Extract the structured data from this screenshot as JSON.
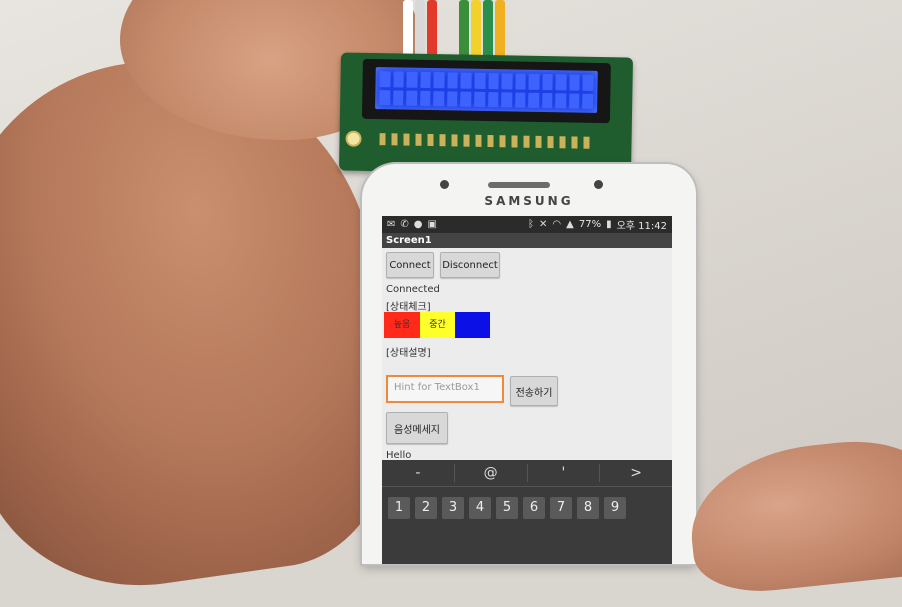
{
  "phone": {
    "brand": "SAMSUNG"
  },
  "status_bar": {
    "battery": "77%",
    "time": "오후 11:42"
  },
  "app": {
    "screen_title": "Screen1",
    "connect_label": "Connect",
    "disconnect_label": "Disconnect",
    "connection_status": "Connected",
    "status_check_label": "[상태체크]",
    "indicators": [
      {
        "label": "높음",
        "color": "#ff2a1a"
      },
      {
        "label": "중간",
        "color": "#ffff2a"
      },
      {
        "label": "",
        "color": "#0a10e6"
      }
    ],
    "status_desc_label": "[상태설명]",
    "textbox": {
      "placeholder": "Hint for TextBox1"
    },
    "send_label": "전송하기",
    "voice_label": "음성메세지",
    "message": "Hello"
  },
  "keyboard": {
    "suggestions": [
      "-",
      "@",
      "'",
      ">"
    ],
    "numbers": [
      "1",
      "2",
      "3",
      "4",
      "5",
      "6",
      "7",
      "8",
      "9"
    ]
  }
}
